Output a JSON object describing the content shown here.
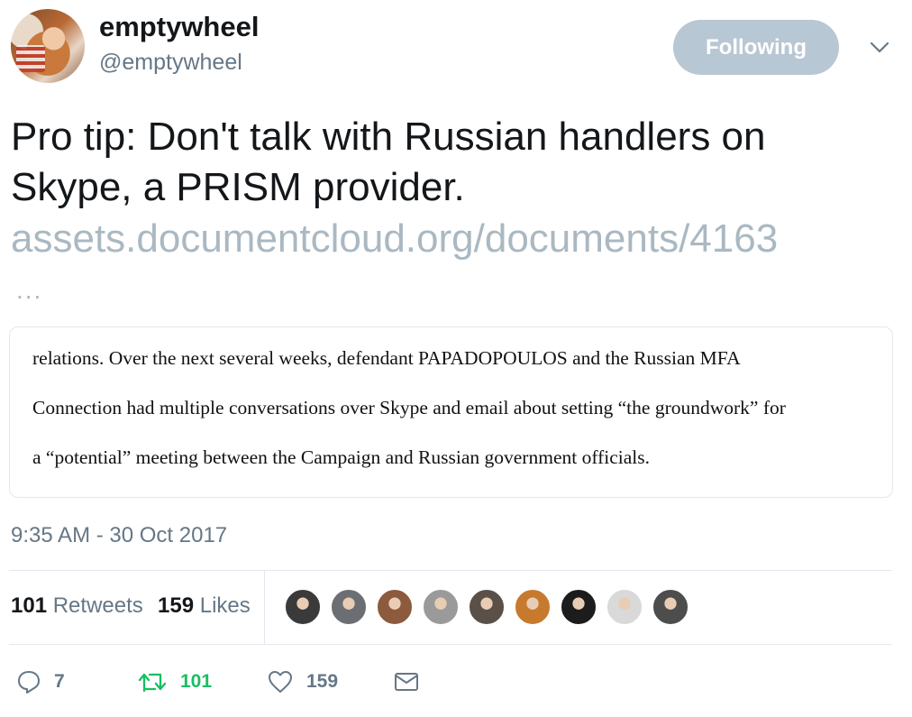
{
  "user": {
    "name": "emptywheel",
    "handle": "@emptywheel",
    "follow_label": "Following"
  },
  "tweet": {
    "text": "Pro tip: Don't talk with Russian handlers on Skype, a PRISM provider.",
    "link": "assets.documentcloud.org/documents/4163",
    "ellipsis": "..."
  },
  "document_excerpt": {
    "lines": [
      "relations.  Over the next several weeks, defendant PAPADOPOULOS and the Russian MFA",
      "Connection had multiple conversations over Skype and email about setting “the groundwork” for",
      "a “potential” meeting between the Campaign and Russian government officials."
    ]
  },
  "timestamp": "9:35 AM - 30 Oct 2017",
  "stats": {
    "retweets_count": "101",
    "retweets_label": "Retweets",
    "likes_count": "159",
    "likes_label": "Likes"
  },
  "likers": [
    {
      "color": "#3a3a3a"
    },
    {
      "color": "#6b6f73"
    },
    {
      "color": "#8c5a3c"
    },
    {
      "color": "#9a9a9a"
    },
    {
      "color": "#5a5048"
    },
    {
      "color": "#c77a2e"
    },
    {
      "color": "#1c1c1c"
    },
    {
      "color": "#d9d9d9"
    },
    {
      "color": "#4d4d4d"
    }
  ],
  "actions": {
    "reply_count": "7",
    "retweet_count": "101",
    "like_count": "159",
    "retweet_color": "#17bf63"
  }
}
